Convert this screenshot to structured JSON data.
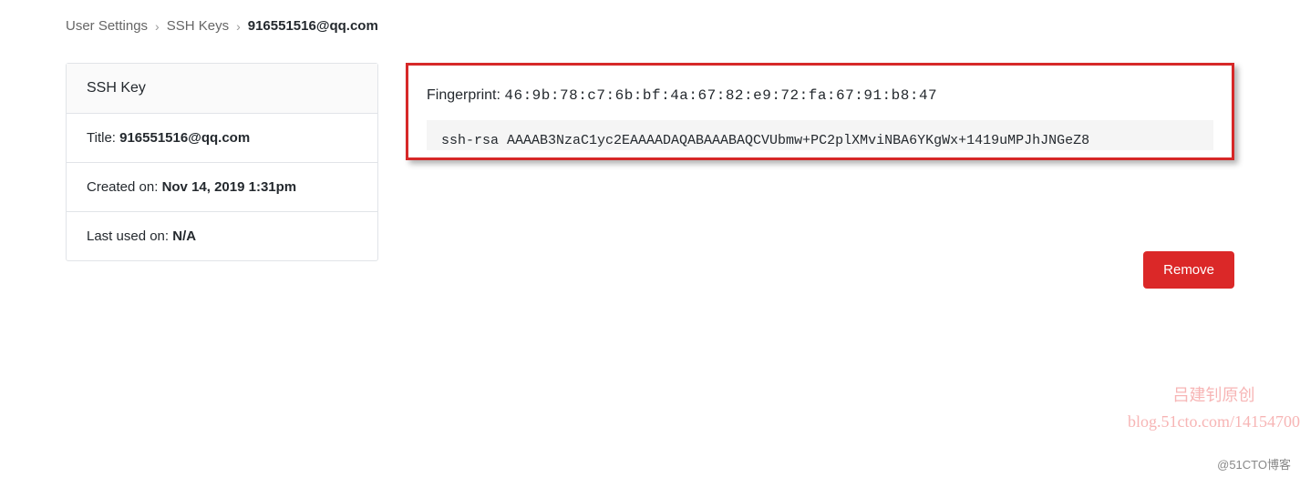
{
  "breadcrumb": {
    "items": [
      {
        "label": "User Settings",
        "link": true
      },
      {
        "label": "SSH Keys",
        "link": true
      },
      {
        "label": "916551516@qq.com",
        "link": false
      }
    ]
  },
  "sidebar": {
    "header": "SSH Key",
    "rows": [
      {
        "label": "Title: ",
        "value": "916551516@qq.com"
      },
      {
        "label": "Created on: ",
        "value": "Nov 14, 2019 1:31pm"
      },
      {
        "label": "Last used on: ",
        "value": "N/A"
      }
    ]
  },
  "fingerprint": {
    "label": "Fingerprint: ",
    "value": "46:9b:78:c7:6b:bf:4a:67:82:e9:72:fa:67:91:b8:47"
  },
  "ssh_key": "ssh-rsa AAAAB3NzaC1yc2EAAAADAQABAAABAQCVUbmw+PC2plXMviNBA6YKgWx+1419uMPJhJNGeZ8",
  "actions": {
    "remove_label": "Remove"
  },
  "watermark": {
    "line1": "吕建钊原创",
    "line2": "blog.51cto.com/14154700",
    "footer": "@51CTO博客"
  }
}
